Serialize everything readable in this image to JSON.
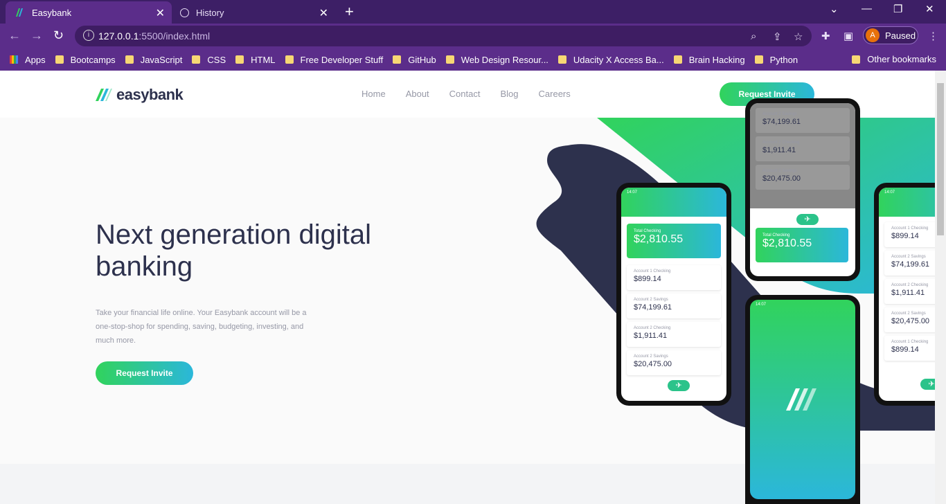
{
  "browser": {
    "tabs": [
      {
        "title": "Easybank",
        "active": true
      },
      {
        "title": "History",
        "active": false
      }
    ],
    "url_host": "127.0.0.1",
    "url_rest": ":5500/index.html",
    "profile_initial": "A",
    "profile_status": "Paused",
    "bookmarks": [
      "Apps",
      "Bootcamps",
      "JavaScript",
      "CSS",
      "HTML",
      "Free Developer Stuff",
      "GitHub",
      "Web Design Resour...",
      "Udacity X Access Ba...",
      "Brain Hacking",
      "Python"
    ],
    "other_bookmarks": "Other bookmarks"
  },
  "site": {
    "logo_text": "easybank",
    "nav": [
      "Home",
      "About",
      "Contact",
      "Blog",
      "Careers"
    ],
    "header_cta": "Request Invite",
    "hero_title": "Next generation digital banking",
    "hero_description": "Take your financial life online. Your Easybank account will be a one-stop-shop for spending, saving, budgeting, investing, and much more.",
    "hero_cta": "Request Invite"
  },
  "mockups": {
    "time": "14:07",
    "total_label": "Total Checking",
    "total_value": "$2,810.55",
    "accounts": [
      {
        "label": "Account 1 Checking",
        "value": "$899.14"
      },
      {
        "label": "Account 2 Savings",
        "value": "$74,199.61"
      },
      {
        "label": "Account 2 Checking",
        "value": "$1,911.41"
      },
      {
        "label": "Account 2 Savings",
        "value": "$20,475.00"
      }
    ],
    "colors": {
      "dark": "#2d314d",
      "green": "#31d35c",
      "cyan": "#2bb7da"
    }
  }
}
